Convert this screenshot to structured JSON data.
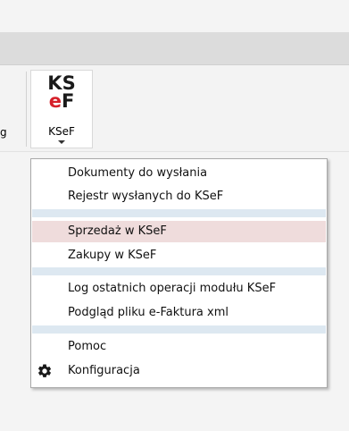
{
  "ribbon": {
    "edge_text": "g",
    "ksef_button": {
      "logo_line1": "KS",
      "logo_e": "e",
      "logo_f": "F",
      "label": "KSeF"
    }
  },
  "menu": {
    "groups": [
      [
        "Dokumenty do wysłania",
        "Rejestr wysłanych do KSeF"
      ],
      [
        "Sprzedaż w KSeF",
        "Zakupy w KSeF"
      ],
      [
        "Log ostatnich operacji modułu KSeF",
        "Podgląd pliku e-Faktura xml"
      ],
      [
        "Pomoc",
        "Konfiguracja"
      ]
    ],
    "hovered_item": "Sprzedaż w KSeF",
    "icons": {
      "Konfiguracja": "gear-icon"
    }
  },
  "colors": {
    "tab_strip": "#dcdcdc",
    "menu_hover": "#efdcdc",
    "menu_separator": "#dde8f1",
    "logo_red": "#d6202a"
  }
}
